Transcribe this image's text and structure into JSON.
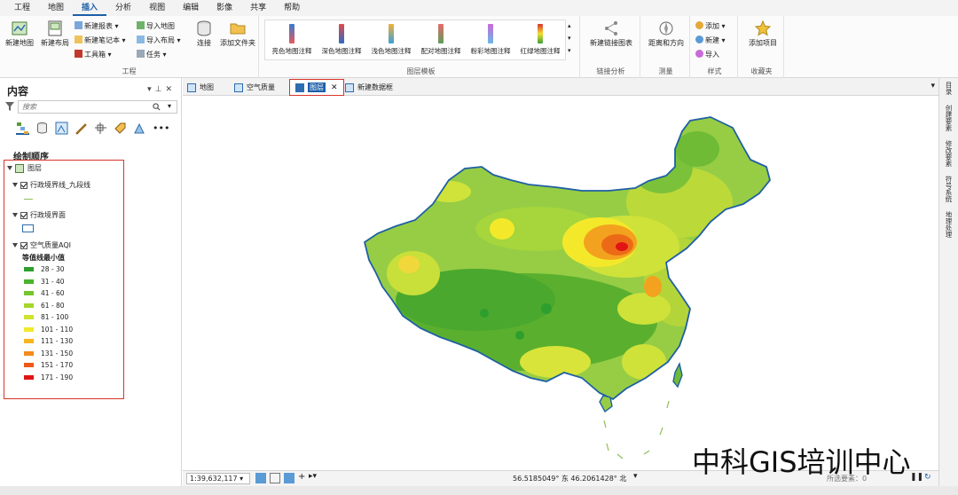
{
  "menu": {
    "tabs": [
      "工程",
      "地图",
      "插入",
      "分析",
      "视图",
      "编辑",
      "影像",
      "共享",
      "帮助"
    ],
    "active_tab": "插入"
  },
  "ribbon": {
    "project": {
      "new_map": "新建地图",
      "new_layout": "新建布局",
      "new_report": "新建报表",
      "new_notebook": "新建笔记本",
      "toolbox": "工具箱",
      "import_map": "导入地图",
      "import_layout": "导入布局",
      "task": "任务",
      "connect": "连接",
      "add_folder": "添加文件夹",
      "label": "工程"
    },
    "layer_templates": {
      "items": [
        "亮色地图注释",
        "深色地图注释",
        "浅色地图注释",
        "配对地图注释",
        "粉彩地图注释",
        "红绿地图注释"
      ],
      "label": "图层模板"
    },
    "link_analysis": {
      "new_link_chart": "新建链接图表",
      "label": "链接分析"
    },
    "measure": {
      "distance_direction": "距离和方向",
      "label": "测量"
    },
    "styles": {
      "add": "添加",
      "new": "新建",
      "import": "导入",
      "label": "样式"
    },
    "favorites": {
      "add_item": "添加项目",
      "label": "收藏夹"
    }
  },
  "contents": {
    "title": "内容",
    "search_placeholder": "搜索",
    "draw_order": "绘制顺序",
    "tree": {
      "root": "图层",
      "layer1": "行政境界线_九段线",
      "layer2": "行政境界面",
      "layer3": "空气质量AQI",
      "legend_title": "等值线最小值",
      "legend": [
        {
          "label": "28 - 30",
          "color": "#2e9e2e"
        },
        {
          "label": "31 - 40",
          "color": "#4ab32e"
        },
        {
          "label": "41 - 60",
          "color": "#74c52e"
        },
        {
          "label": "61 - 80",
          "color": "#a4d62e"
        },
        {
          "label": "81 - 100",
          "color": "#cfe32e"
        },
        {
          "label": "101 - 110",
          "color": "#f3e92a"
        },
        {
          "label": "111 - 130",
          "color": "#f7b51f"
        },
        {
          "label": "131 - 150",
          "color": "#f38a1b"
        },
        {
          "label": "151 - 170",
          "color": "#ec5a17"
        },
        {
          "label": "171 - 190",
          "color": "#e11414"
        }
      ]
    }
  },
  "view_tabs": {
    "tab1": "地图",
    "tab2": "空气质量",
    "tab3": "图层",
    "tab4": "新建数据框"
  },
  "status": {
    "scale": "1:39,632,117",
    "coords": "56.5185049° 东 46.2061428° 北",
    "selected": "所选要素：0"
  },
  "right_rail": [
    "目录",
    "创建要素",
    "修改要素",
    "符号系统",
    "地理处理"
  ],
  "watermark": "中科GIS培训中心",
  "colors": {
    "accent": "#1c5fa8",
    "highlight_box": "#d9342b",
    "boundary": "#1f5fa3"
  }
}
